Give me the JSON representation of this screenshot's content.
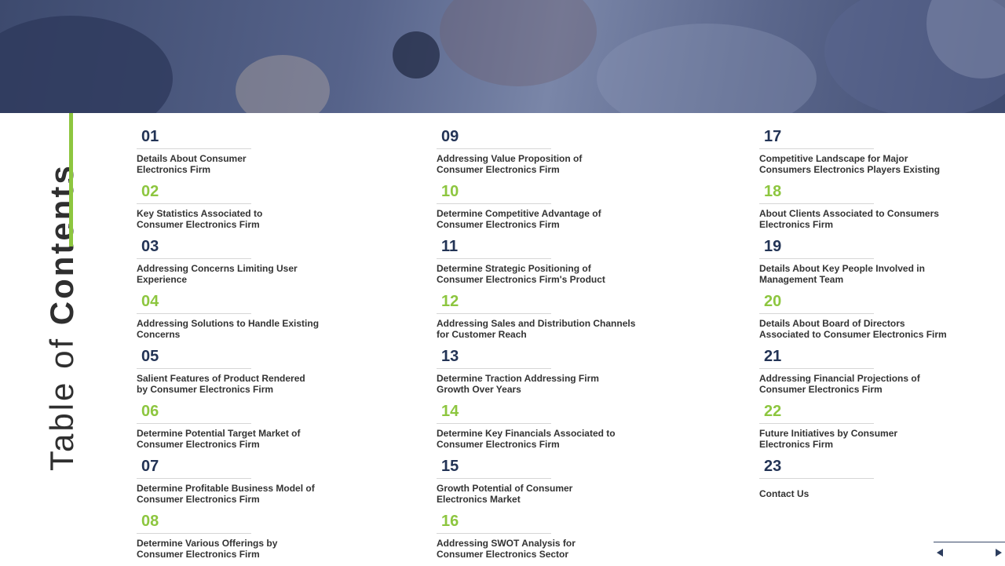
{
  "slide": {
    "title_light": "Table of",
    "title_bold": "Contents"
  },
  "toc": {
    "col1": [
      {
        "num": "01",
        "text": "Details About Consumer\nElectronics Firm"
      },
      {
        "num": "02",
        "text": "Key Statistics Associated to\nConsumer Electronics Firm"
      },
      {
        "num": "03",
        "text": "Addressing Concerns Limiting User\nExperience"
      },
      {
        "num": "04",
        "text": "Addressing Solutions to Handle Existing\nConcerns"
      },
      {
        "num": "05",
        "text": "Salient Features of Product Rendered\nby Consumer Electronics Firm"
      },
      {
        "num": "06",
        "text": "Determine Potential Target Market of\nConsumer Electronics Firm"
      },
      {
        "num": "07",
        "text": "Determine Profitable Business Model of\nConsumer Electronics Firm"
      },
      {
        "num": "08",
        "text": "Determine Various Offerings by\nConsumer Electronics Firm"
      }
    ],
    "col2": [
      {
        "num": "09",
        "text": "Addressing Value Proposition of\nConsumer Electronics Firm"
      },
      {
        "num": "10",
        "text": "Determine Competitive Advantage of\nConsumer Electronics Firm"
      },
      {
        "num": "11",
        "text": "Determine Strategic Positioning of\nConsumer Electronics Firm's Product"
      },
      {
        "num": "12",
        "text": "Addressing Sales and Distribution Channels\nfor Customer Reach"
      },
      {
        "num": "13",
        "text": "Determine Traction Addressing Firm\nGrowth Over Years"
      },
      {
        "num": "14",
        "text": "Determine Key Financials Associated to\nConsumer Electronics Firm"
      },
      {
        "num": "15",
        "text": "Growth Potential of Consumer\nElectronics Market"
      },
      {
        "num": "16",
        "text": "Addressing SWOT Analysis for\nConsumer Electronics Sector"
      }
    ],
    "col3": [
      {
        "num": "17",
        "text": "Competitive Landscape for Major\nConsumers Electronics Players Existing"
      },
      {
        "num": "18",
        "text": "About Clients Associated to Consumers\nElectronics Firm"
      },
      {
        "num": "19",
        "text": "Details About Key People Involved in\nManagement Team"
      },
      {
        "num": "20",
        "text": "Details About Board of Directors\nAssociated to Consumer Electronics Firm"
      },
      {
        "num": "21",
        "text": "Addressing Financial Projections of\nConsumer Electronics Firm"
      },
      {
        "num": "22",
        "text": "Future Initiatives by Consumer\nElectronics Firm"
      },
      {
        "num": "23",
        "text": "Contact Us"
      }
    ]
  },
  "colors": {
    "dark_number": "#223355",
    "green_number": "#8dc63f",
    "accent_bar": "#8dc63f",
    "hero_tint": "#4a5680"
  }
}
